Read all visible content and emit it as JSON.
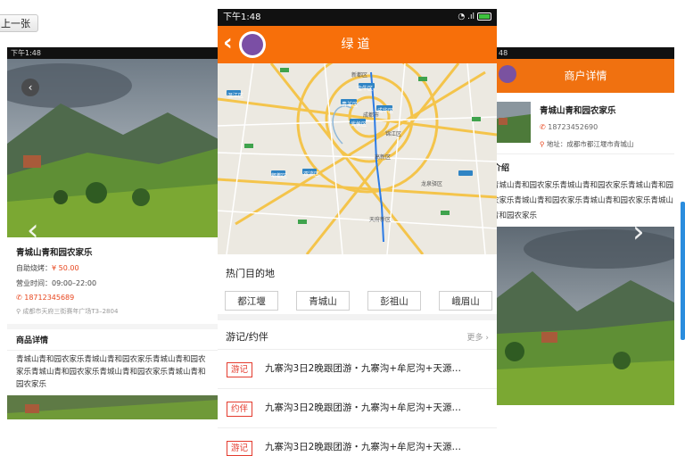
{
  "prev_button": "上一张",
  "left_card": {
    "status_time": "下午1:48",
    "title": "青城山青和园农家乐",
    "price_label": "自助烧烤：",
    "price_value": "¥ 50.00",
    "hours_label": "营业时间：",
    "hours_value": "09:00–22:00",
    "phone": "18712345689",
    "address": "成都市天府三街赛年广场T3–2804",
    "section_title": "商品详情",
    "description": "青城山青和园农家乐青城山青和园农家乐青城山青和园农家乐青城山青和园农家乐青城山青和园农家乐青城山青和园农家乐"
  },
  "center_phone": {
    "status_time": "下午1:48",
    "header_title": "绿道",
    "map_labels": [
      "金牛区",
      "青羊区",
      "成都市",
      "成华区",
      "武侯区",
      "锦江区",
      "高新区",
      "双流区",
      "郫都区",
      "温江区",
      "天府新区",
      "龙泉驿区",
      "新都区"
    ],
    "hot_title": "热门目的地",
    "destinations": [
      "都江堰",
      "青城山",
      "彭祖山",
      "峨眉山"
    ],
    "travel_title": "游记/约伴",
    "more_label": "更多",
    "travel_items": [
      {
        "badge": "游记",
        "text": "九寨沟3日2晚跟团游・九寨沟+牟尼沟+天源…"
      },
      {
        "badge": "约伴",
        "text": "九寨沟3日2晚跟团游・九寨沟+牟尼沟+天源…"
      },
      {
        "badge": "游记",
        "text": "九寨沟3日2晚跟团游・九寨沟+牟尼沟+天源…"
      }
    ]
  },
  "right_card": {
    "header_title": "商户详情",
    "merchant_name": "青城山青和园农家乐",
    "phone": "18723452690",
    "address": "地址：成都市都江堰市青城山",
    "section_title": "介绍",
    "description": "青城山青和园农家乐青城山青和园农家乐青城山青和园农家乐青城山青和园农家乐青城山青和园农家乐青城山青和园农家乐"
  },
  "colors": {
    "accent": "#f76f0a",
    "badge_red": "#e43b2e",
    "scroll": "#2b8dde"
  }
}
